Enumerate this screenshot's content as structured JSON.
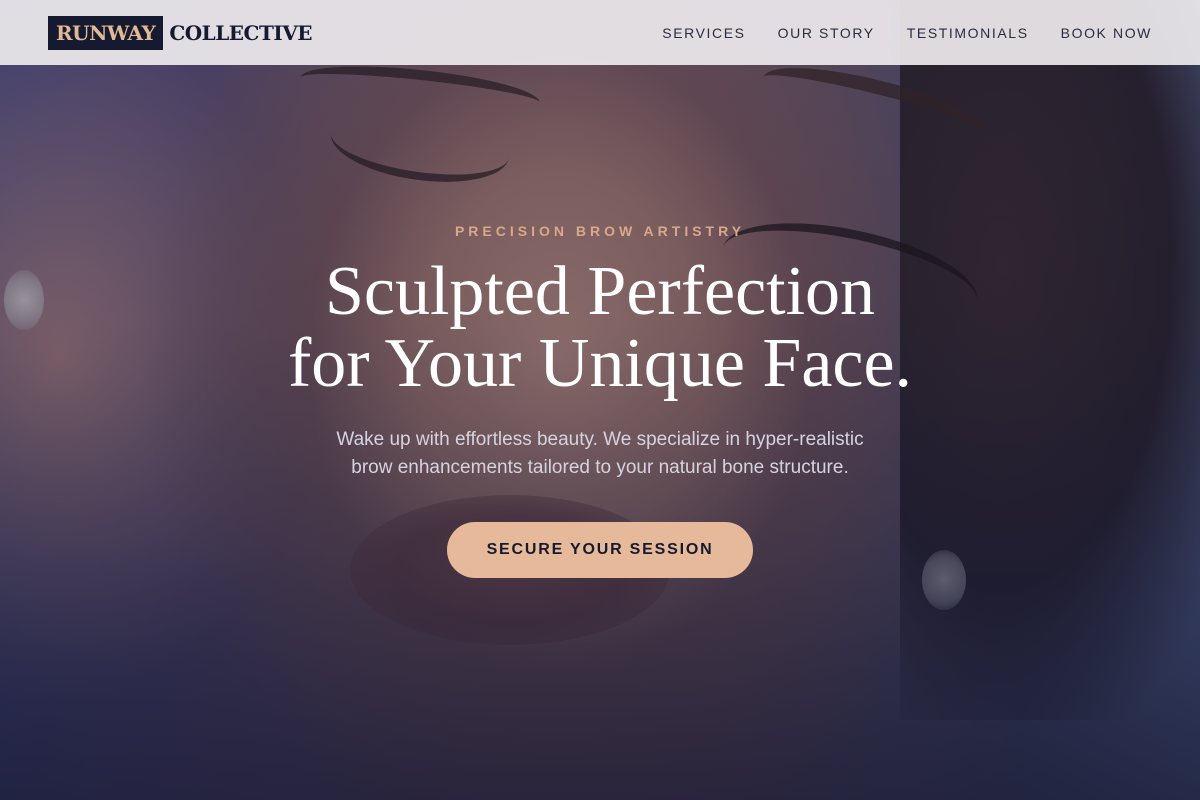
{
  "brand": {
    "logo_highlight": "RUNWAY",
    "logo_rest": "COLLECTIVE",
    "colors": {
      "navy": "#151a30",
      "peach": "#e5b99a",
      "eyebrow": "#d8a88a"
    }
  },
  "nav": {
    "items": [
      {
        "label": "SERVICES"
      },
      {
        "label": "OUR STORY"
      },
      {
        "label": "TESTIMONIALS"
      },
      {
        "label": "BOOK NOW"
      }
    ]
  },
  "hero": {
    "eyebrow": "PRECISION BROW ARTISTRY",
    "headline_line1": "Sculpted Perfection",
    "headline_line2": "for Your Unique Face.",
    "subtext_line1": "Wake up with effortless beauty. We specialize in hyper-realistic",
    "subtext_line2": "brow enhancements tailored to your natural bone structure.",
    "cta_label": "SECURE YOUR SESSION"
  }
}
